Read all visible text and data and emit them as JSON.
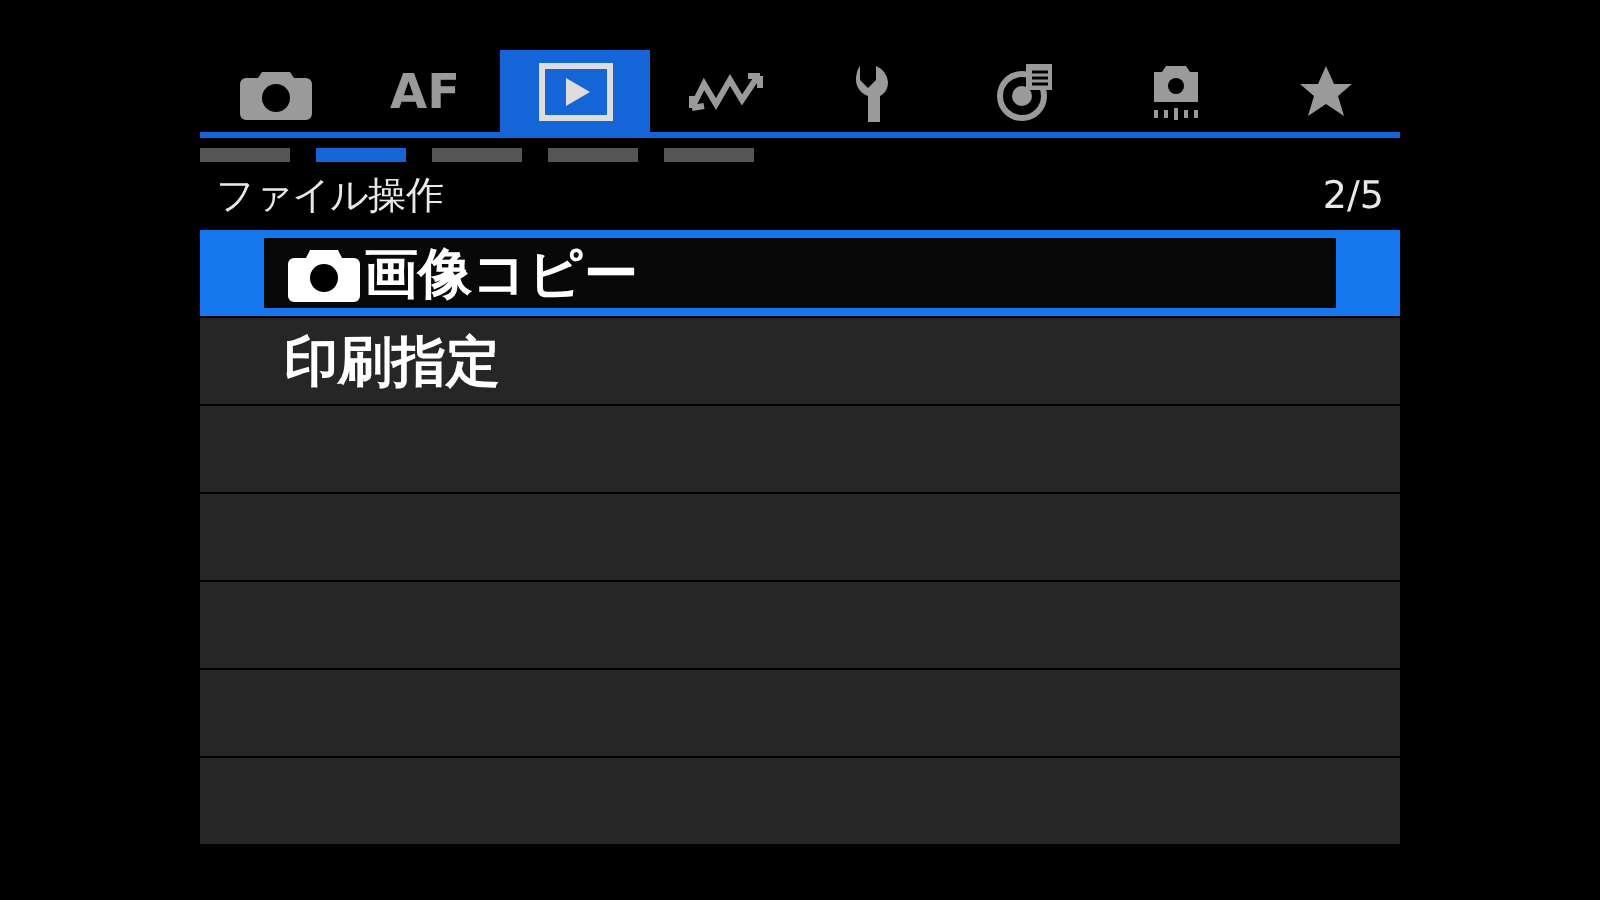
{
  "tabs": [
    {
      "kind": "camera",
      "selected": false
    },
    {
      "kind": "text",
      "label": "AF",
      "selected": false
    },
    {
      "kind": "play",
      "selected": true
    },
    {
      "kind": "wave",
      "selected": false
    },
    {
      "kind": "wrench",
      "selected": false
    },
    {
      "kind": "dial",
      "selected": false
    },
    {
      "kind": "custom",
      "selected": false
    },
    {
      "kind": "star",
      "selected": false
    }
  ],
  "pages": [
    {
      "selected": false
    },
    {
      "selected": true
    },
    {
      "selected": false
    },
    {
      "selected": false
    },
    {
      "selected": false
    }
  ],
  "header": {
    "title": "ファイル操作",
    "page": "2/5"
  },
  "items": [
    {
      "label": "画像コピー",
      "kind": "camera",
      "selected": true
    },
    {
      "label": "印刷指定",
      "kind": "plain",
      "selected": false
    }
  ]
}
